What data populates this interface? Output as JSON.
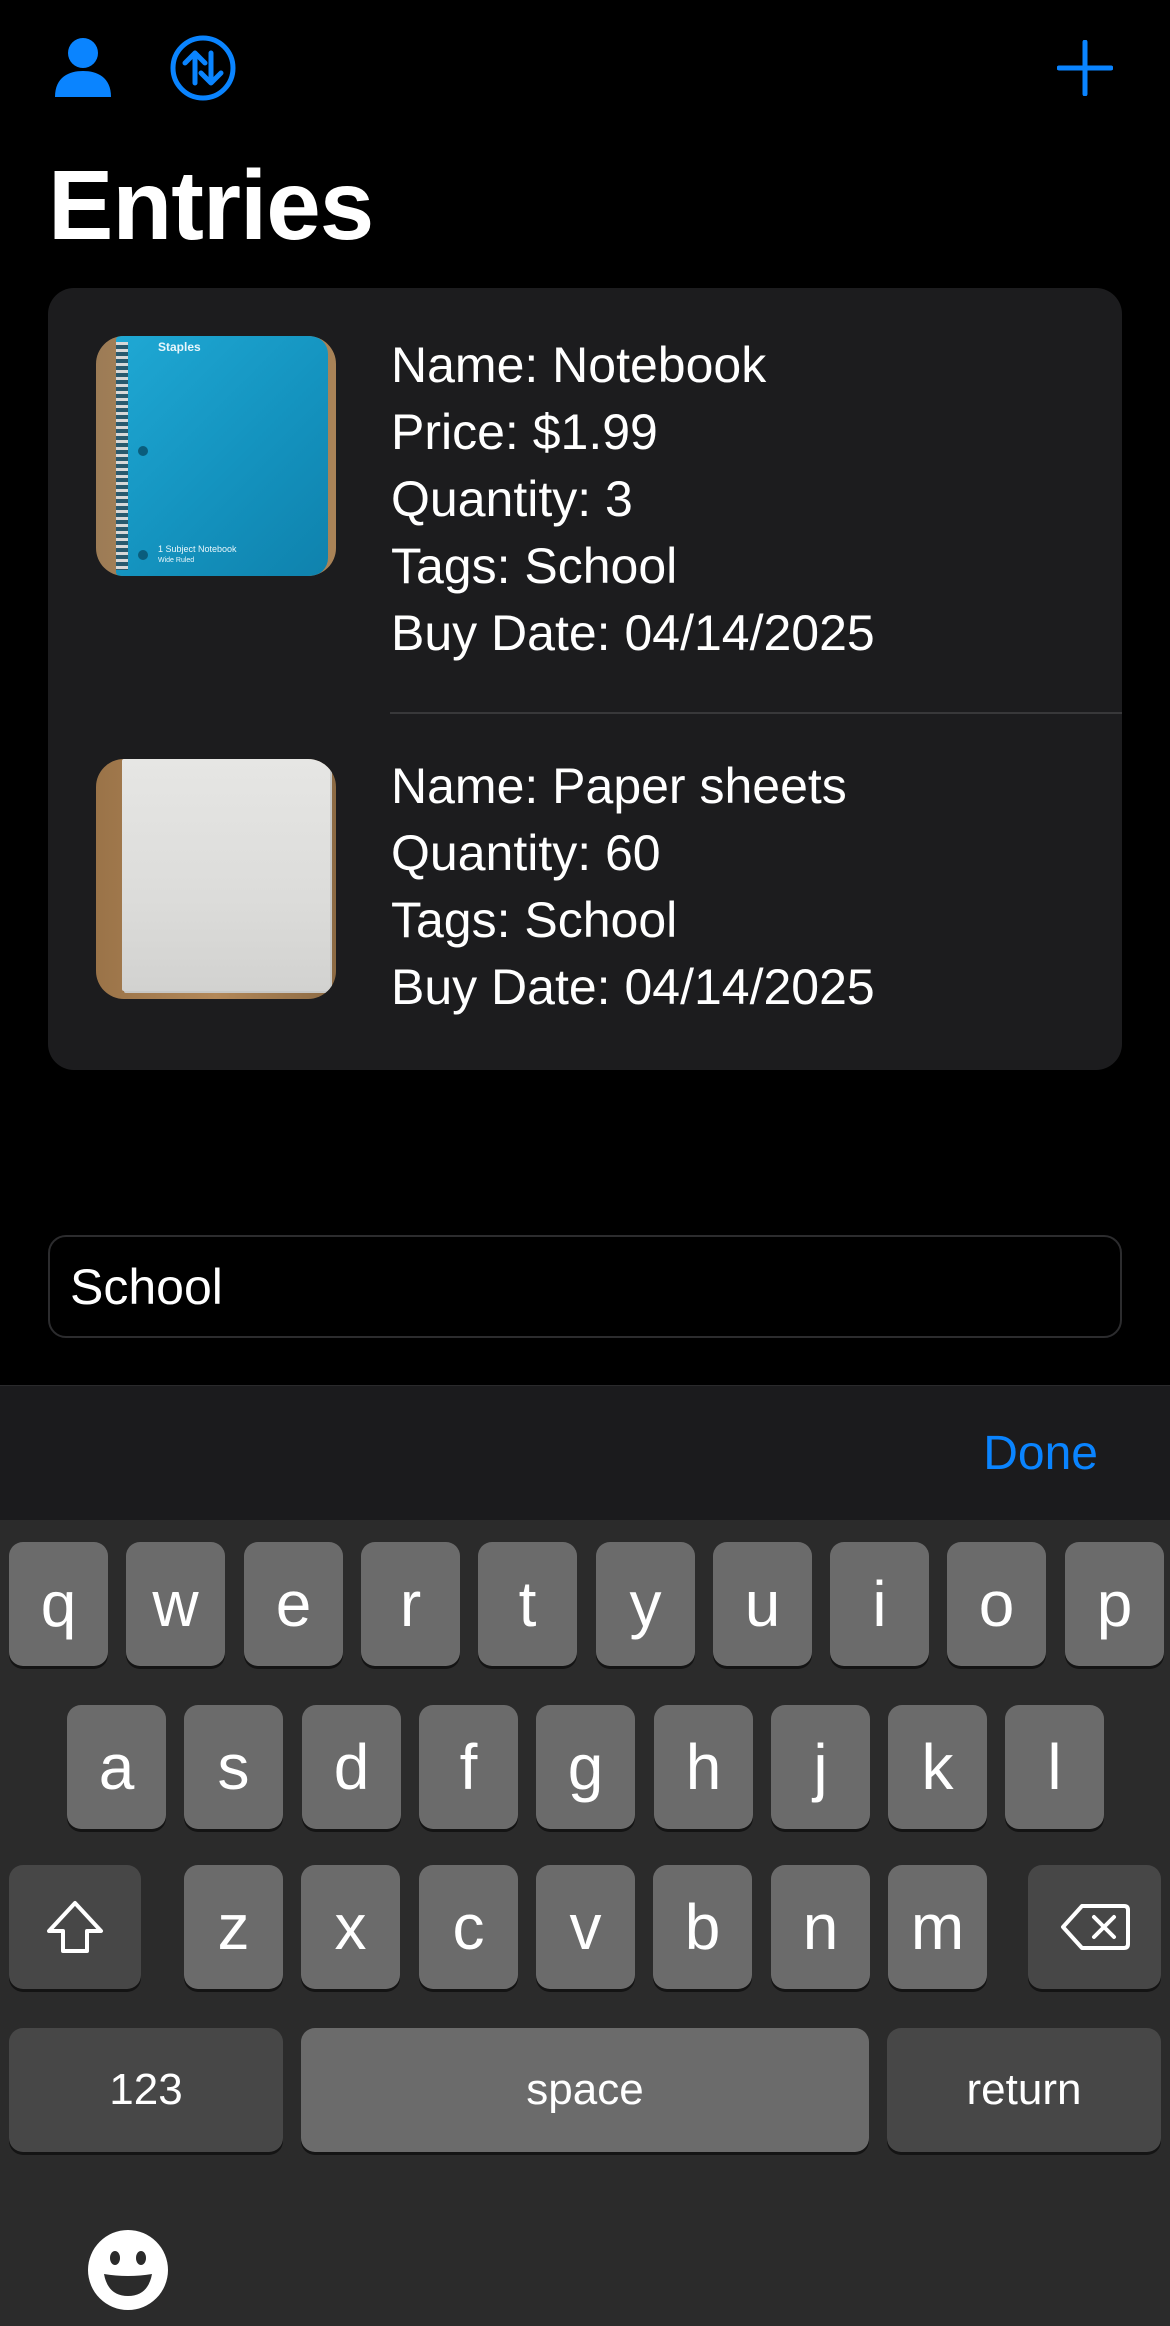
{
  "header": {
    "title": "Entries",
    "profile_icon": "person-icon",
    "sort_icon": "arrow-up-arrow-down-circle-icon",
    "add_icon": "plus-icon",
    "accent_color": "#0a84ff"
  },
  "entries": [
    {
      "name": "Name: Notebook",
      "price": "Price: $1.99",
      "quantity": "Quantity: 3",
      "tags": "Tags: School",
      "buy_date": "Buy Date: 04/14/2025",
      "thumb_brand": "Staples",
      "thumb_label_1": "1 Subject Notebook",
      "thumb_label_2": "Wide Ruled"
    },
    {
      "name": "Name: Paper sheets",
      "quantity": "Quantity: 60",
      "tags": "Tags: School",
      "buy_date": "Buy Date: 04/14/2025"
    }
  ],
  "search": {
    "value": "School"
  },
  "keyboard": {
    "done": "Done",
    "row1": [
      "q",
      "w",
      "e",
      "r",
      "t",
      "y",
      "u",
      "i",
      "o",
      "p"
    ],
    "row2": [
      "a",
      "s",
      "d",
      "f",
      "g",
      "h",
      "j",
      "k",
      "l"
    ],
    "row3": [
      "z",
      "x",
      "c",
      "v",
      "b",
      "n",
      "m"
    ],
    "numbers": "123",
    "space": "space",
    "return": "return",
    "shift_icon": "shift-icon",
    "delete_icon": "delete-backward-icon",
    "emoji_icon": "emoji-icon"
  }
}
